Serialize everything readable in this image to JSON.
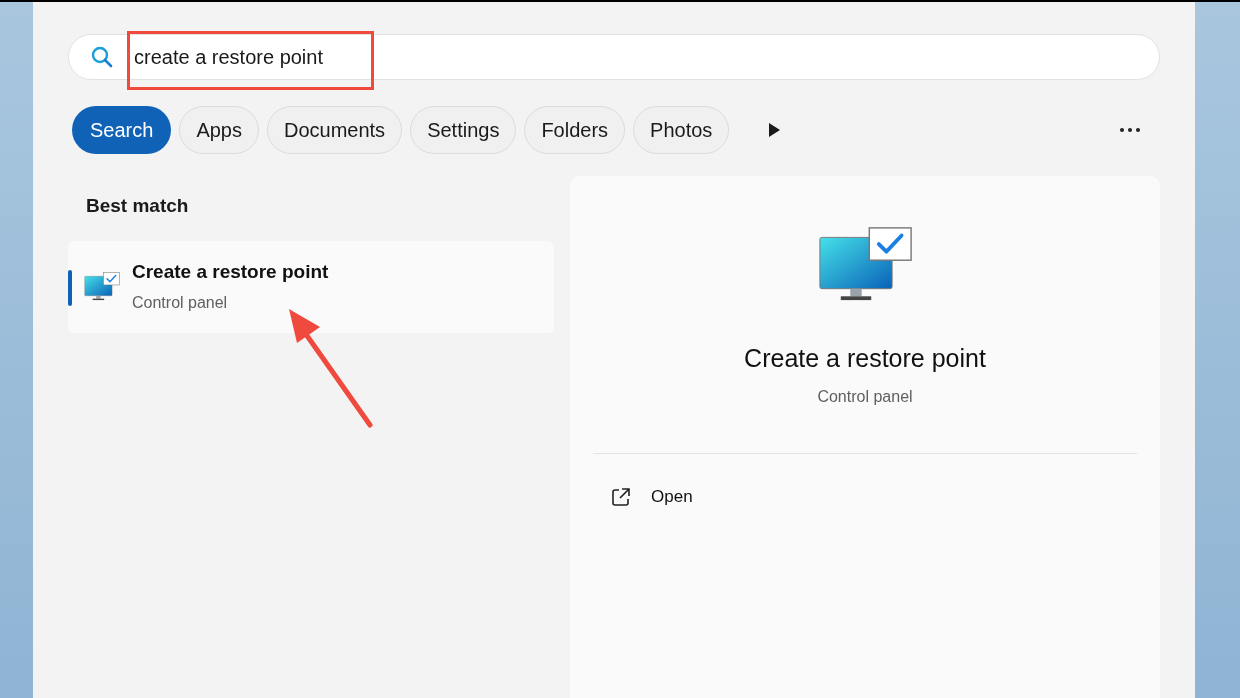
{
  "search": {
    "value": "create a restore point"
  },
  "filters": [
    {
      "label": "Search",
      "selected": true
    },
    {
      "label": "Apps",
      "selected": false
    },
    {
      "label": "Documents",
      "selected": false
    },
    {
      "label": "Settings",
      "selected": false
    },
    {
      "label": "Folders",
      "selected": false
    },
    {
      "label": "Photos",
      "selected": false
    }
  ],
  "results": {
    "heading": "Best match",
    "items": [
      {
        "title": "Create a restore point",
        "subtitle": "Control panel",
        "selected": true
      }
    ]
  },
  "preview": {
    "title": "Create a restore point",
    "subtitle": "Control panel",
    "actions": [
      {
        "label": "Open"
      }
    ]
  }
}
